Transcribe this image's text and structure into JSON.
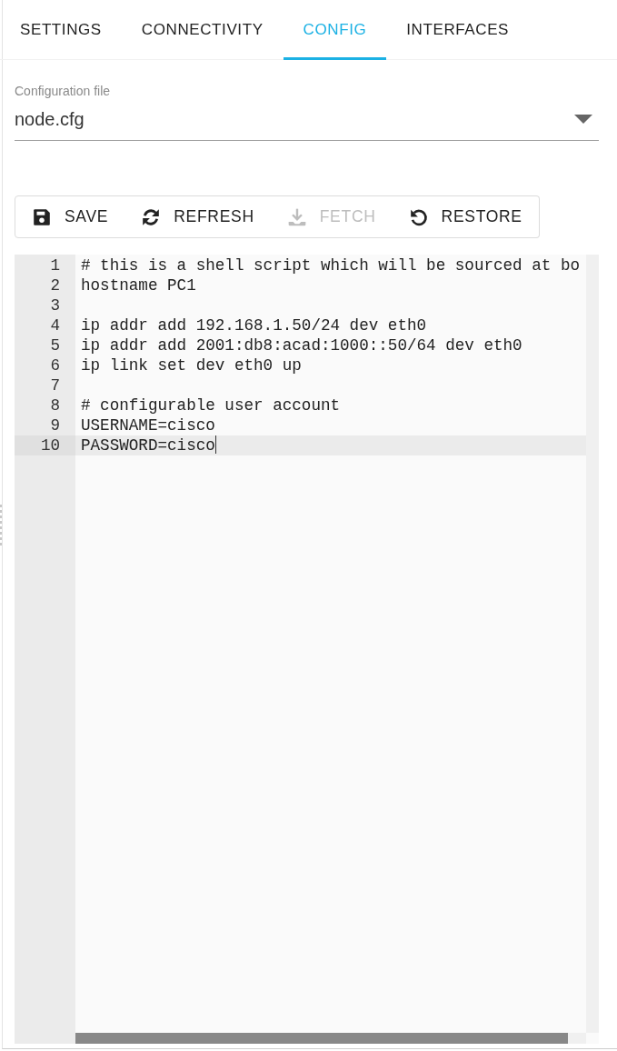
{
  "tabs": [
    {
      "label": "SETTINGS",
      "selected": false
    },
    {
      "label": "CONNECTIVITY",
      "selected": false
    },
    {
      "label": "CONFIG",
      "selected": true
    },
    {
      "label": "INTERFACES",
      "selected": false
    }
  ],
  "config_file": {
    "label": "Configuration file",
    "value": "node.cfg"
  },
  "toolbar": [
    {
      "kind": "save",
      "label": "SAVE",
      "disabled": false
    },
    {
      "kind": "refresh",
      "label": "REFRESH",
      "disabled": false
    },
    {
      "kind": "fetch",
      "label": "FETCH",
      "disabled": true
    },
    {
      "kind": "restore",
      "label": "RESTORE",
      "disabled": false
    }
  ],
  "editor": {
    "lines": [
      {
        "number": "1",
        "text": "# this is a shell script which will be sourced at bo",
        "active": false
      },
      {
        "number": "2",
        "text": "hostname PC1",
        "active": false
      },
      {
        "number": "3",
        "active": false
      },
      {
        "number": "4",
        "text": "ip addr add 192.168.1.50/24 dev eth0",
        "active": false
      },
      {
        "number": "5",
        "text": "ip addr add 2001:db8:acad:1000::50/64 dev eth0",
        "active": false
      },
      {
        "number": "6",
        "text": "ip link set dev eth0 up",
        "active": false
      },
      {
        "number": "7",
        "active": false
      },
      {
        "number": "8",
        "text": "# configurable user account",
        "active": false
      },
      {
        "number": "9",
        "text": "USERNAME=cisco",
        "active": false
      },
      {
        "number": "10",
        "text": "PASSWORD=cisco",
        "active": true
      }
    ]
  }
}
